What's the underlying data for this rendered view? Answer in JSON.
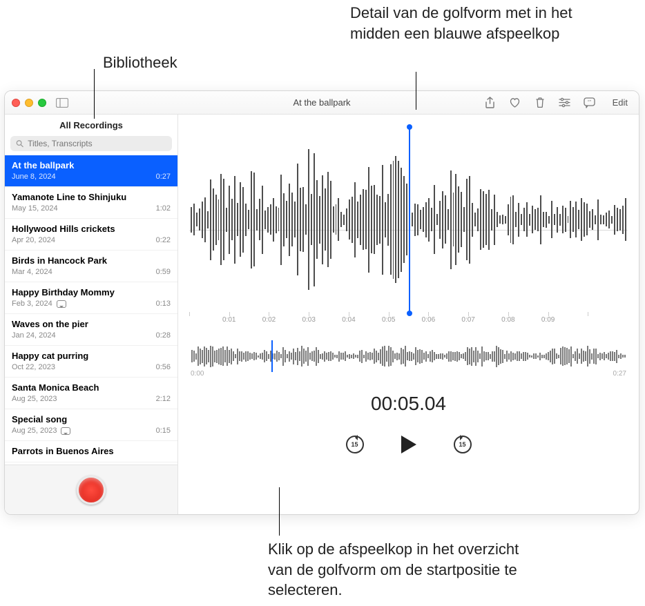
{
  "annotations": {
    "bib": "Bibliotheek",
    "detail": "Detail van de golfvorm met in het midden een blauwe afspeelkop",
    "overview": "Klik op de afspeelkop in het overzicht van de golfvorm om de startpositie te selecteren."
  },
  "window": {
    "title": "At the ballpark",
    "edit_label": "Edit"
  },
  "sidebar": {
    "header": "All Recordings",
    "search_placeholder": "Titles, Transcripts",
    "items": [
      {
        "title": "At the ballpark",
        "date": "June 8, 2024",
        "dur": "0:27",
        "selected": true
      },
      {
        "title": "Yamanote Line to Shinjuku",
        "date": "May 15, 2024",
        "dur": "1:02"
      },
      {
        "title": "Hollywood Hills crickets",
        "date": "Apr 20, 2024",
        "dur": "0:22"
      },
      {
        "title": "Birds in Hancock Park",
        "date": "Mar 4, 2024",
        "dur": "0:59"
      },
      {
        "title": "Happy Birthday Mommy",
        "date": "Feb 3, 2024",
        "dur": "0:13",
        "transcript": true
      },
      {
        "title": "Waves on the pier",
        "date": "Jan 24, 2024",
        "dur": "0:28"
      },
      {
        "title": "Happy cat purring",
        "date": "Oct 22, 2023",
        "dur": "0:56"
      },
      {
        "title": "Santa Monica Beach",
        "date": "Aug 25, 2023",
        "dur": "2:12"
      },
      {
        "title": "Special song",
        "date": "Aug 25, 2023",
        "dur": "0:15",
        "transcript": true
      },
      {
        "title": "Parrots in Buenos Aires",
        "date": "",
        "dur": "",
        "partial": true
      }
    ]
  },
  "detail": {
    "ruler": [
      "",
      "0:01",
      "0:02",
      "0:03",
      "0:04",
      "0:05",
      "0:06",
      "0:07",
      "0:08",
      "0:09",
      ""
    ],
    "playhead_pct": 50
  },
  "overview": {
    "start": "0:00",
    "end": "0:27",
    "playhead_pct": 18.6
  },
  "playback": {
    "timecode": "00:05.04",
    "skip_amount": "15"
  },
  "colors": {
    "accent": "#0a60ff",
    "record": "#ff3b30"
  }
}
